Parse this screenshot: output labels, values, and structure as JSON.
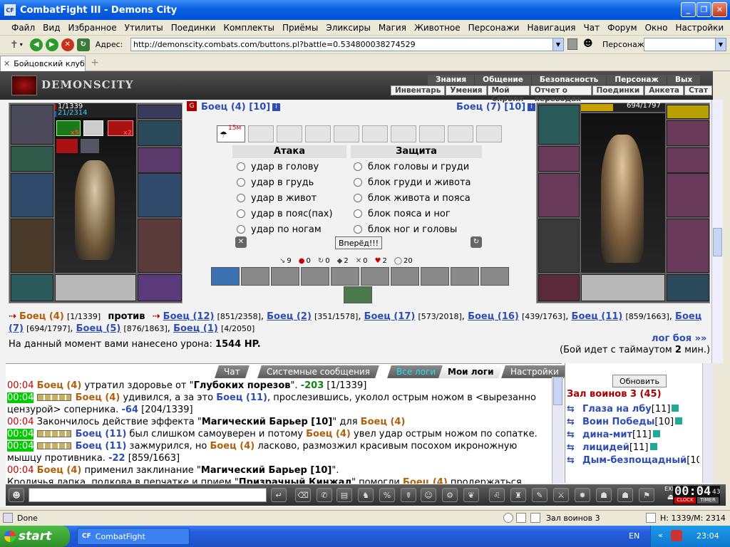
{
  "window": {
    "title": "CombatFight III - Demons City",
    "app_icon": "CF"
  },
  "menu": [
    "Файл",
    "Вид",
    "Избранное",
    "Утилиты",
    "Поединки",
    "Комплекты",
    "Приёмы",
    "Эликсиры",
    "Магия",
    "Животное",
    "Персонажи",
    "Навигация",
    "Чат",
    "Форум",
    "Окно",
    "Настройки",
    "?"
  ],
  "address": {
    "label": "Адрес:",
    "url": "http://demonscity.combats.com/buttons.pl?battle=0.534800038274529",
    "char_label": "Персонаж:"
  },
  "tab": {
    "label": "Бойцовский клуб"
  },
  "banner": {
    "logo": "DEMONSCITY",
    "nav1": [
      "Знания",
      "Общение",
      "Безопасность",
      "Персонаж",
      "Вых"
    ],
    "nav2": [
      "Инвентарь",
      "Умения",
      "Мой Скролл",
      "Отчет о переводах",
      "Поединки",
      "Анкета",
      "Стат"
    ]
  },
  "left_char": {
    "hp": "1/1339",
    "mana": "21/2314",
    "badge1": "x5",
    "badge2": "x2"
  },
  "right_char": {
    "hp": "694/1797"
  },
  "fight": {
    "me": "Боец (4) [10]",
    "enemy": "Боец (7) [10]",
    "timer_badge": "15м",
    "attack_header": "Атака",
    "defense_header": "Защита",
    "attacks": [
      "удар в голову",
      "удар в грудь",
      "удар в живот",
      "удар в пояс(пах)",
      "удар по ногам"
    ],
    "blocks": [
      "блок головы и груди",
      "блок груди и живота",
      "блок живота и пояса",
      "блок пояса и ног",
      "блок ног и головы"
    ],
    "go_button": "Вперёд!!!",
    "stats": [
      "9",
      "0",
      "0",
      "2",
      "0",
      "2",
      "20"
    ]
  },
  "versus": {
    "me": "Боец (4)",
    "me_hp": "[1/1339]",
    "vs": "против",
    "enemies": [
      {
        "name": "Боец (12)",
        "hp": "[851/2358]"
      },
      {
        "name": "Боец (2)",
        "hp": "[351/1578]"
      },
      {
        "name": "Боец (17)",
        "hp": "[573/2018]"
      },
      {
        "name": "Боец (16)",
        "hp": "[439/1763]"
      },
      {
        "name": "Боец (11)",
        "hp": "[859/1663]"
      },
      {
        "name": "Боец (7)",
        "hp": "[694/1797]"
      },
      {
        "name": "Боец (5)",
        "hp": "[876/1863]"
      },
      {
        "name": "Боец (1)",
        "hp": "[4/2050]"
      }
    ]
  },
  "damage": {
    "label": "На данный момент вами нанесено урона:",
    "value": "1544 HP."
  },
  "log_link": "лог боя »»",
  "timeout": {
    "pre": "(Бой идет с таймаутом",
    "val": "2",
    "post": "мин.)"
  },
  "chat_tabs": [
    "Чат",
    "Системные сообщения",
    "Все логи",
    "Мои логи",
    "Настройки"
  ],
  "log": [
    {
      "t": "00:04",
      "parts": [
        [
          "n",
          "Боец (4)"
        ],
        [
          "x",
          " утратил здоровье от \""
        ],
        [
          "b",
          "Глубоких порезов"
        ],
        [
          "x",
          "\". "
        ],
        [
          "g",
          "-203"
        ],
        [
          "x",
          " [1/1339]"
        ]
      ]
    },
    {
      "t": "00:04",
      "green": true,
      "parts": [
        [
          "n",
          "Боец (4)"
        ],
        [
          "x",
          " удивился, а за это "
        ],
        [
          "e",
          "Боец (11)"
        ],
        [
          "x",
          ", прослезившись, уколол острым ножом в <вырезанно"
        ]
      ]
    },
    {
      "t": "",
      "parts": [
        [
          "x",
          "цензурой> соперника. "
        ],
        [
          "e",
          "-64"
        ],
        [
          "x",
          " [204/1339]"
        ]
      ]
    },
    {
      "t": "00:04",
      "parts": [
        [
          "x",
          "Закончилось действие эффекта \""
        ],
        [
          "b",
          "Магический Барьер [10]"
        ],
        [
          "x",
          "\" для "
        ],
        [
          "n",
          "Боец (4)"
        ]
      ]
    },
    {
      "t": "00:04",
      "green": true,
      "parts": [
        [
          "e",
          "Боец (11)"
        ],
        [
          "x",
          " был слишком самоуверен и потому "
        ],
        [
          "n",
          "Боец (4)"
        ],
        [
          "x",
          " увел удар острым ножом по сопатке."
        ]
      ]
    },
    {
      "t": "00:04",
      "green": true,
      "parts": [
        [
          "e",
          "Боец (11)"
        ],
        [
          "x",
          " зажмурился, но "
        ],
        [
          "n",
          "Боец (4)"
        ],
        [
          "x",
          " ласково, размозжил красивым посохом икроножную"
        ]
      ]
    },
    {
      "t": "",
      "parts": [
        [
          "x",
          "мышцу противника. "
        ],
        [
          "e",
          "-22"
        ],
        [
          "x",
          " [859/1663]"
        ]
      ]
    },
    {
      "t": "00:04",
      "parts": [
        [
          "n",
          "Боец (4)"
        ],
        [
          "x",
          " применил заклинание \""
        ],
        [
          "b",
          "Магический Барьер [10]"
        ],
        [
          "x",
          "\"."
        ]
      ]
    },
    {
      "t": "",
      "parts": [
        [
          "x",
          "Кроличья лапка, подкова в перчатке и прием \""
        ],
        [
          "b",
          "Призрачный Кинжал"
        ],
        [
          "x",
          "\" помогли "
        ],
        [
          "n",
          "Боец (4)"
        ],
        [
          "x",
          " продержаться"
        ]
      ]
    }
  ],
  "room": {
    "refresh": "Обновить",
    "title": "Зал воинов 3 (45)",
    "users": [
      {
        "name": "Глаза на лбу",
        "lvl": "[11]"
      },
      {
        "name": "Воин Победы",
        "lvl": "[10]"
      },
      {
        "name": "дина-мит",
        "lvl": "[11]"
      },
      {
        "name": "лицидей",
        "lvl": "[11]"
      },
      {
        "name": "Дым-безпощадный",
        "lvl": "[10"
      }
    ]
  },
  "clock": {
    "time": "00:04",
    "sub": "43",
    "clock_label": "CLOCK",
    "timer_label": "TIMER",
    "exit": "EXIT"
  },
  "status": {
    "left": "Done",
    "zone": "Зал воинов 3",
    "hp": "H: 1339/M: 2314"
  },
  "taskbar": {
    "start": "start",
    "item": "CombatFight",
    "lang": "EN",
    "time": "23:04"
  },
  "colors": {
    "accent": "#2d4db2",
    "enemy_name": "#2d4db2",
    "my_name": "#b05f0a",
    "xp_blue": "#0a5fe0"
  }
}
